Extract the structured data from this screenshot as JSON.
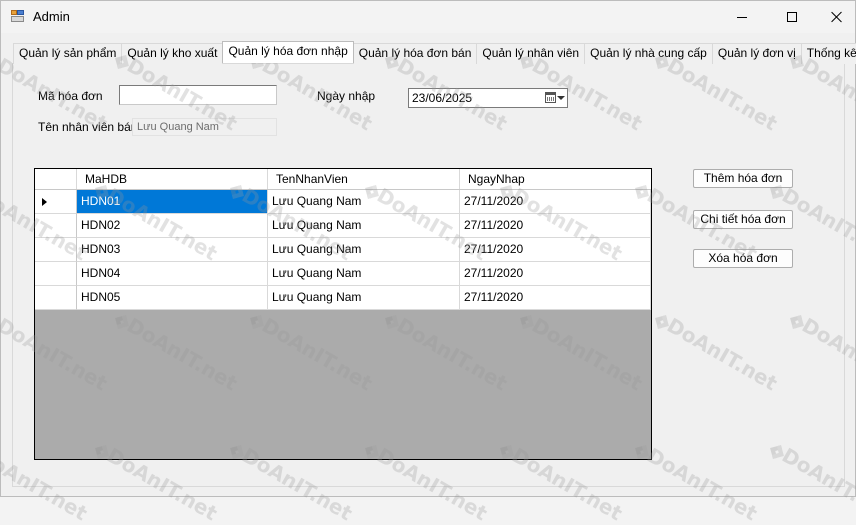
{
  "window": {
    "title": "Admin",
    "controls": {
      "minimize": "minimize",
      "maximize": "maximize",
      "close": "close"
    }
  },
  "tabs": [
    {
      "label": "Quản lý sản phẩm",
      "active": false
    },
    {
      "label": "Quản lý kho xuất",
      "active": false
    },
    {
      "label": "Quản lý hóa đơn nhập",
      "active": true
    },
    {
      "label": "Quản lý hóa đơn bán",
      "active": false
    },
    {
      "label": "Quản lý nhân viên",
      "active": false
    },
    {
      "label": "Quản lý nhà cung cấp",
      "active": false
    },
    {
      "label": "Quản lý đơn vị",
      "active": false
    },
    {
      "label": "Thống kê",
      "active": false
    }
  ],
  "form": {
    "invoice_id_label": "Mã hóa đơn",
    "invoice_id_value": "",
    "date_label": "Ngày nhập",
    "date_value": "23/06/2025",
    "employee_label": "Tên nhân viên bán",
    "employee_value": "Lưu Quang Nam"
  },
  "grid": {
    "columns": [
      "MaHDB",
      "TenNhanVien",
      "NgayNhap"
    ],
    "rows": [
      [
        "HDN01",
        "Lưu Quang Nam",
        "27/11/2020"
      ],
      [
        "HDN02",
        "Lưu Quang Nam",
        "27/11/2020"
      ],
      [
        "HDN03",
        "Lưu Quang Nam",
        "27/11/2020"
      ],
      [
        "HDN04",
        "Lưu Quang Nam",
        "27/11/2020"
      ],
      [
        "HDN05",
        "Lưu Quang Nam",
        "27/11/2020"
      ]
    ],
    "selected_row": 0
  },
  "buttons": {
    "add": "Thêm hóa đơn",
    "detail": "Chi tiết hóa đơn",
    "delete": "Xóa hóa đơn"
  },
  "watermark": {
    "text": "DoAnIT.net"
  },
  "colors": {
    "selection": "#0078d7",
    "grid_background": "#ababab",
    "window_background": "#f0f0f0"
  }
}
